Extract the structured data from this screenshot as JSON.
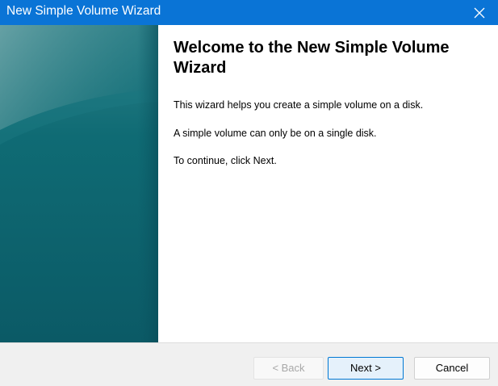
{
  "window": {
    "title": "New Simple Volume Wizard",
    "close_icon": "close-icon",
    "title_bar_color": "#0a74d6"
  },
  "side_panel": {
    "colors": [
      "#3f8a90",
      "#0d6b73",
      "#0f5d69",
      "#0a5867"
    ]
  },
  "content": {
    "heading": "Welcome to the New Simple Volume Wizard",
    "paragraphs": [
      "This wizard helps you create a simple volume on a disk.",
      "A simple volume can only be on a single disk.",
      "To continue, click Next."
    ]
  },
  "footer": {
    "back_label": "< Back",
    "next_label": "Next >",
    "cancel_label": "Cancel"
  }
}
